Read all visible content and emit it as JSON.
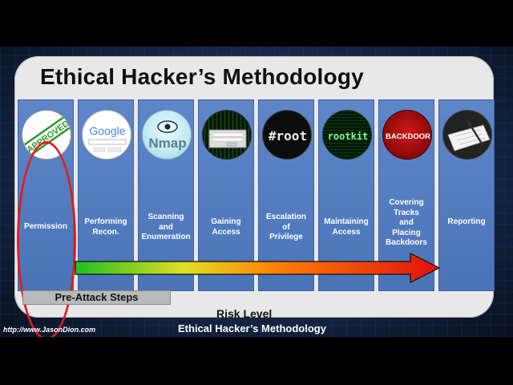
{
  "title": "Ethical Hacker’s Methodology",
  "steps": [
    {
      "label": "Permission",
      "image_icon": "approved-stamp-icon",
      "image_text": "APPROVED"
    },
    {
      "label": "Performing\nRecon.",
      "image_icon": "google-search-icon",
      "image_text": "Google"
    },
    {
      "label": "Scanning\nand\nEnumeration",
      "image_icon": "nmap-eye-icon",
      "image_text": "Nmap"
    },
    {
      "label": "Gaining\nAccess",
      "image_icon": "login-screen-icon",
      "image_text": ""
    },
    {
      "label": "Escalation\nof\nPrivilege",
      "image_icon": "root-icon",
      "image_text": "#root"
    },
    {
      "label": "Maintaining\nAccess",
      "image_icon": "rootkit-icon",
      "image_text": "rootkit"
    },
    {
      "label": "Covering\nTracks\nand\nPlacing\nBackdoors",
      "image_icon": "backdoor-icon",
      "image_text": "BACKDOOR"
    },
    {
      "label": "Reporting",
      "image_icon": "report-writing-icon",
      "image_text": ""
    }
  ],
  "pre_attack_label": "Pre-Attack Steps",
  "risk_label": "Risk Level",
  "footer": {
    "url": "http://www.JasonDion.com",
    "title": "Ethical Hacker’s Methodology"
  },
  "colors": {
    "column_blue": "#4a74b8",
    "highlight_ring": "#e01e1e",
    "risk_gradient": [
      "#20c020",
      "#e0e020",
      "#ff8000",
      "#e01010"
    ]
  }
}
